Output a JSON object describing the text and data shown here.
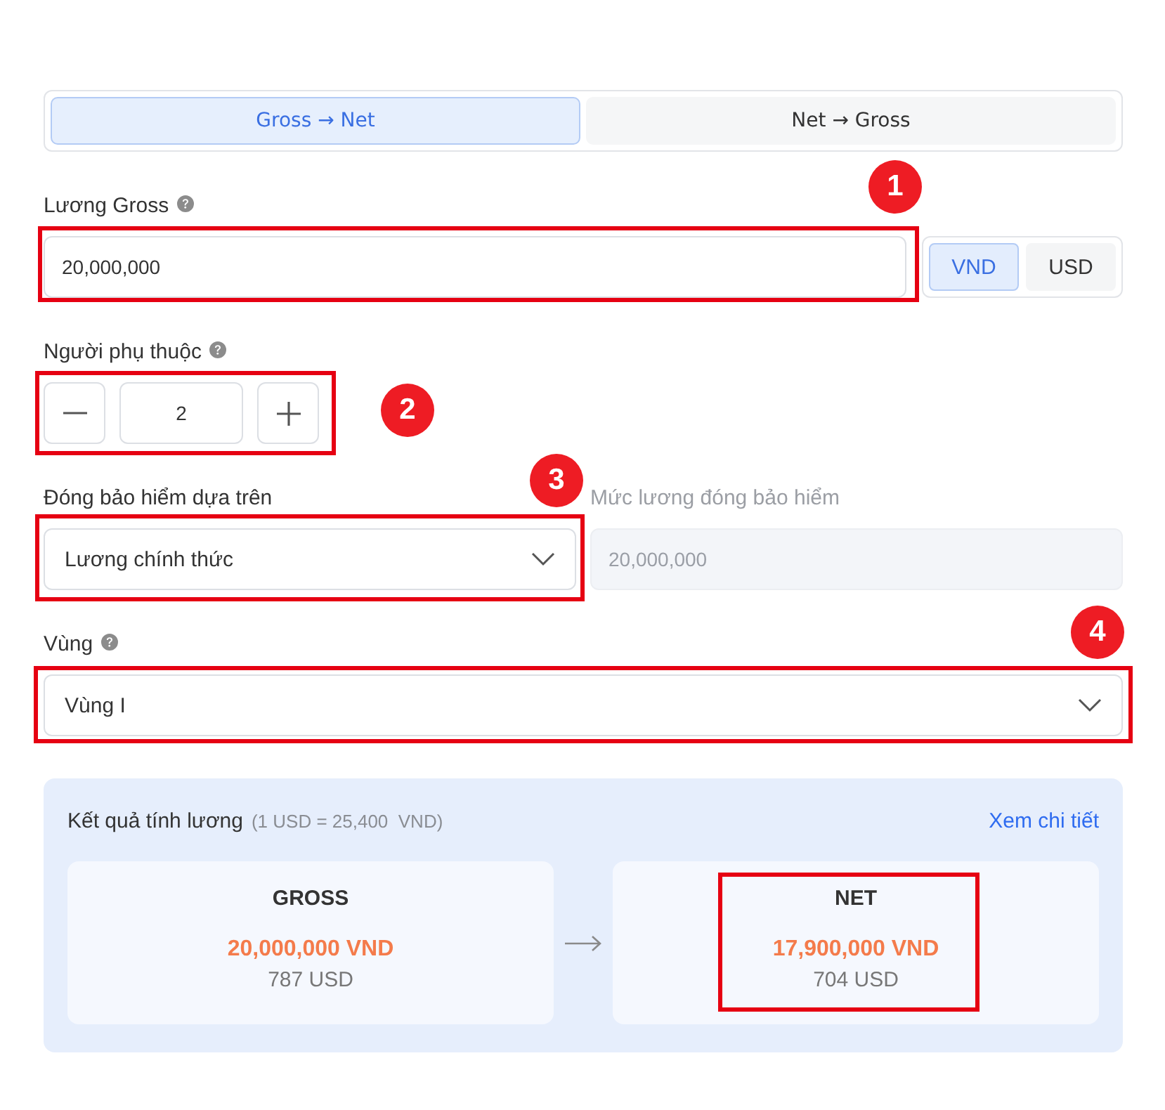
{
  "mode_tabs": [
    {
      "label": "Gross → Net",
      "selected": true
    },
    {
      "label": "Net → Gross",
      "selected": false
    }
  ],
  "gross_salary": {
    "label": "Lương Gross",
    "help": true,
    "value": "20,000,000",
    "highlighted": true,
    "marker": "1",
    "currencies": [
      {
        "label": "VND",
        "selected": true
      },
      {
        "label": "USD",
        "selected": false
      }
    ]
  },
  "dependents": {
    "label": "Người phụ thuộc",
    "help": true,
    "value": "2",
    "highlighted": true,
    "marker": "2"
  },
  "insurance_basis": {
    "label": "Đóng bảo hiểm dựa trên",
    "value": "Lương chính thức",
    "highlighted": true,
    "marker": "3"
  },
  "insurance_salary": {
    "label": "Mức lương đóng bảo hiểm",
    "value": "20,000,000",
    "disabled": true
  },
  "region": {
    "label": "Vùng",
    "help": true,
    "value": "Vùng I",
    "highlighted": true,
    "marker": "4"
  },
  "result": {
    "title": "Kết quả tính lương",
    "rate": "(1 USD = 25,400  VND)",
    "link": "Xem chi tiết",
    "cards": [
      {
        "title": "GROSS",
        "amount": "20,000,000 VND",
        "converted": "787 USD",
        "highlighted": false
      },
      {
        "title": "NET",
        "amount": "17,900,000 VND",
        "converted": "704 USD",
        "highlighted": true
      }
    ]
  }
}
